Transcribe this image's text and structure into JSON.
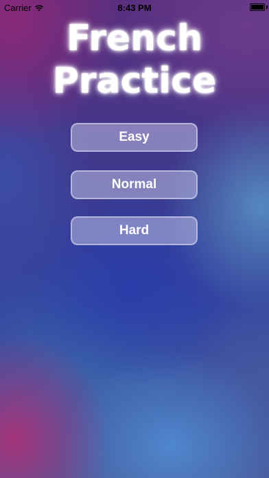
{
  "status_bar": {
    "carrier": "Carrier",
    "time": "8:43 PM",
    "wifi_icon": "wifi-icon",
    "battery_icon": "battery-icon",
    "battery_level": 1.0
  },
  "title": {
    "line1": "French",
    "line2": "Practice"
  },
  "difficulty_buttons": [
    {
      "label": "Easy"
    },
    {
      "label": "Normal"
    },
    {
      "label": "Hard"
    }
  ],
  "colors": {
    "title_text": "#ffffff",
    "button_fill": "#bebee1",
    "button_border": "#c8c8eb",
    "button_text": "#ffffff"
  }
}
